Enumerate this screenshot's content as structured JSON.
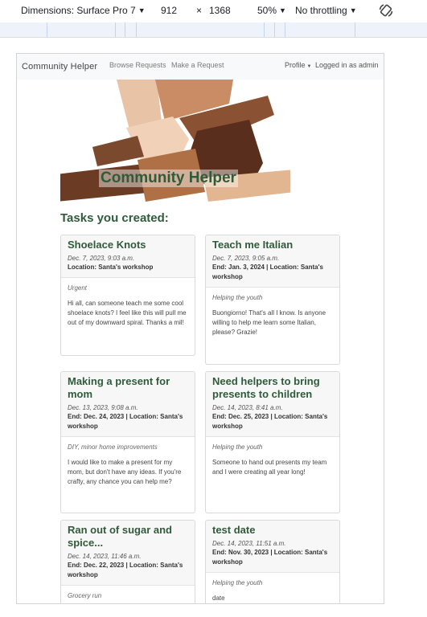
{
  "devtools": {
    "device": "Dimensions: Surface Pro 7",
    "width": "912",
    "times": "×",
    "height": "1368",
    "zoom": "50%",
    "throttling": "No throttling"
  },
  "navbar": {
    "brand": "Community Helper",
    "browse": "Browse Requests",
    "make": "Make a Request",
    "profile": "Profile",
    "logged_in": "Logged in as admin"
  },
  "hero": {
    "title": "Community Helper"
  },
  "section_title": "Tasks you created:",
  "cards": [
    {
      "title": "Shoelace Knots",
      "date": "Dec. 7, 2023, 9:03 a.m.",
      "location": "Location: Santa's workshop",
      "category": "Urgent",
      "description": "Hi all, can someone teach me some cool shoelace knots? I feel like this will pull me out of my downward spiral. Thanks a mil!"
    },
    {
      "title": "Teach me Italian",
      "date": "Dec. 7, 2023, 9:05 a.m.",
      "location": "End: Jan. 3, 2024 | Location: Santa's workshop",
      "category": "Helping the youth",
      "description": "Buongiorno! That's all I know. Is anyone willing to help me learn some Italian, please? Grazie!"
    },
    {
      "title": "Making a present for mom",
      "date": "Dec. 13, 2023, 9:08 a.m.",
      "location": "End: Dec. 24, 2023 | Location: Santa's workshop",
      "category": "DIY, minor home improvements",
      "description": "I would like to make a present for my mom, but don't have any ideas. If you're crafty, any chance you can help me?"
    },
    {
      "title": "Need helpers to bring presents to children",
      "date": "Dec. 14, 2023, 8:41 a.m.",
      "location": "End: Dec. 25, 2023 | Location: Santa's workshop",
      "category": "Helping the youth",
      "description": "Someone to hand out presents my team and I were creating all year long!"
    },
    {
      "title": "Ran out of sugar and spice...",
      "date": "Dec. 14, 2023, 11:46 a.m.",
      "location": "End: Dec. 22, 2023 | Location: Santa's workshop",
      "category": "Grocery run",
      "description": ""
    },
    {
      "title": "test date",
      "date": "Dec. 14, 2023, 11:51 a.m.",
      "location": "End: Nov. 30, 2023 | Location: Santa's workshop",
      "category": "Helping the youth",
      "description": "date"
    }
  ],
  "colors": {
    "accent_green": "#2f5b3a",
    "navbar_bg": "#f8f9fa",
    "card_header_bg": "#f7f7f7"
  }
}
